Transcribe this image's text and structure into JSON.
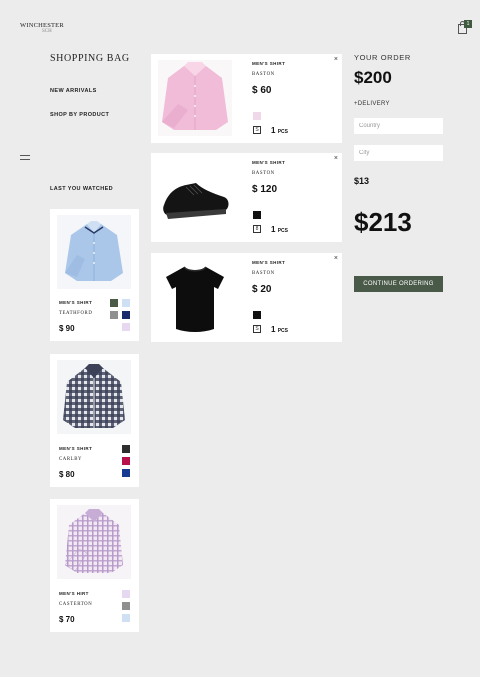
{
  "brand": {
    "logo": "WINCHESTER",
    "logo_sub": "SCH"
  },
  "header": {
    "cart_count": "1"
  },
  "nav": {
    "title": "SHOPPING BAG",
    "links": [
      "NEW ARRIVALS",
      "SHOP BY PRODUCT"
    ]
  },
  "watched": {
    "title": "LAST YOU WATCHED",
    "items": [
      {
        "name": "MEN'S SHIRT",
        "sub": "TEATHFORD",
        "price": "$ 90",
        "swatches": [
          "#4b5b45",
          "#cfe0f4",
          "#8f8f8f",
          "#1b2a6b",
          "#e6d8f0"
        ]
      },
      {
        "name": "MEN'S SHIRT",
        "sub": "CARLBY",
        "price": "$ 80",
        "swatches": [
          "#2e2e2e",
          "#b8104a",
          "#173a93"
        ]
      },
      {
        "name": "MEN'S HIRT",
        "sub": "CASTERTON",
        "price": "$ 70",
        "swatches": [
          "#e6d8f0",
          "#8f8f8f",
          "#cfe0f4"
        ]
      }
    ]
  },
  "cart": {
    "items": [
      {
        "name": "MEN'S SHIRT",
        "sub": "BASTON",
        "price": "$ 60",
        "color": "#f1d8e8",
        "qty_box": "S",
        "qty": "1",
        "unit": "PCS",
        "remove": "×"
      },
      {
        "name": "MEN'S SHIRT",
        "sub": "BASTON",
        "price": "$ 120",
        "color": "#111111",
        "qty_box": "8",
        "qty": "1",
        "unit": "PCS",
        "remove": "×"
      },
      {
        "name": "MEN'S SHIRT",
        "sub": "BASTON",
        "price": "$ 20",
        "color": "#111111",
        "qty_box": "S",
        "qty": "1",
        "unit": "PCS",
        "remove": "×"
      }
    ]
  },
  "order": {
    "title": "YOUR ORDER",
    "subtotal": "$200",
    "delivery_label": "+DELIVERY",
    "country_placeholder": "Country",
    "city_placeholder": "City",
    "delivery_cost": "$13",
    "total": "$213",
    "continue_label": "CONTINUE ORDERING"
  }
}
